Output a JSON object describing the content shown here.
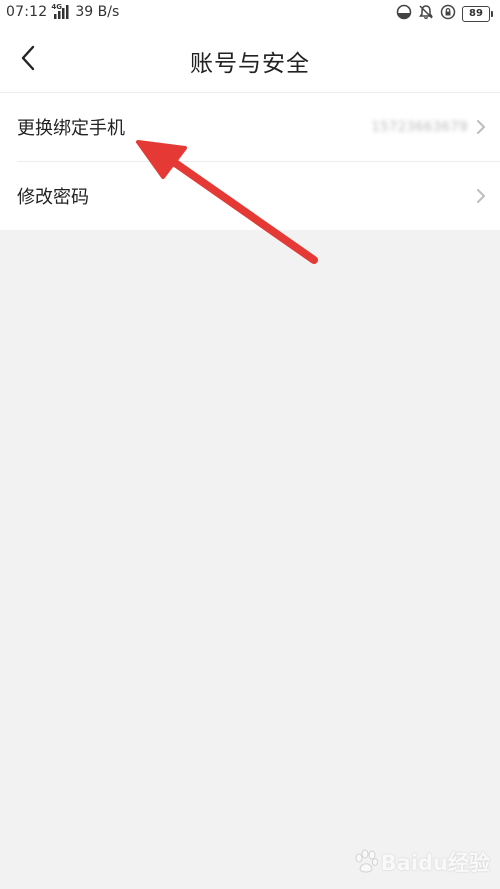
{
  "status_bar": {
    "time": "07:12",
    "network_type": "4G",
    "net_speed": "39 B/s",
    "battery": "89",
    "icons": [
      "signal-icon",
      "data-saver-icon",
      "bell-mute-icon",
      "lock-rotation-icon",
      "battery-icon"
    ]
  },
  "nav": {
    "title": "账号与安全",
    "back_icon": "chevron-left-icon"
  },
  "menu": {
    "items": [
      {
        "label": "更换绑定手机",
        "value": "15723663679",
        "icon": "chevron-right-icon"
      },
      {
        "label": "修改密码",
        "value": "",
        "icon": "chevron-right-icon"
      }
    ]
  },
  "annotation": {
    "arrow_color": "#e53935"
  },
  "watermark": {
    "text": "Baidu经验"
  }
}
